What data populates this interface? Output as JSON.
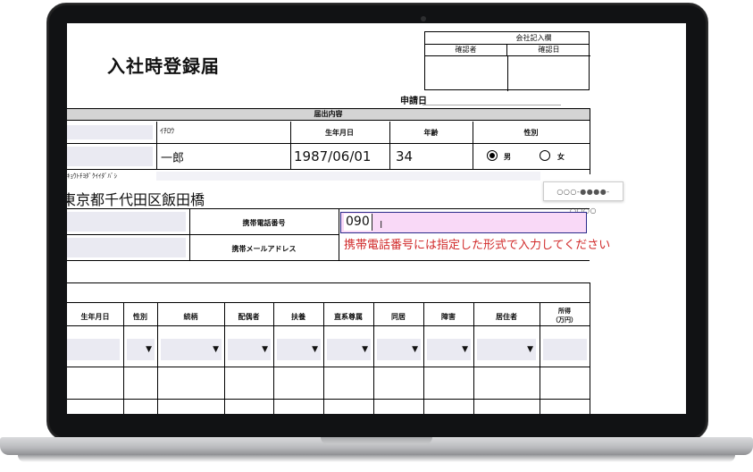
{
  "form": {
    "title": "入社時登録届",
    "stamp": {
      "header": "会社記入欄",
      "confirmer": "確認者",
      "confirm_date": "確認日"
    },
    "apply_date_label": "申請日",
    "section_label": "届出内容",
    "name_kana_value": "ｲﾁﾛｳ",
    "name_value": "一郎",
    "birth_label": "生年月日",
    "birth_value": "1987/06/01",
    "age_label": "年齢",
    "age_value": "34",
    "gender_label": "性別",
    "gender_male": "男",
    "gender_female": "女",
    "gender_selected": "男",
    "address_kana": "ｷｮｳﾄﾁﾖﾀﾞｸｲｲﾀﾞﾊﾞｼ",
    "address_value": "東京都千代田区飯田橋",
    "mobile_label": "携帯電話番号",
    "mobile_value": "090",
    "mobile_placeholder_hint": "○○○-●●●●-○○○○",
    "mobile_mail_label": "携帯メールアドレス",
    "error_message": "携帯電話番号には指定した形式で入力してください"
  },
  "family_table": {
    "headers": [
      "生年月日",
      "性別",
      "続柄",
      "配偶者",
      "扶養",
      "直系尊属",
      "同居",
      "障害",
      "居住者"
    ],
    "income_header_line1": "所得",
    "income_header_line2": "（万円）",
    "dropdown_arrow": "▼"
  }
}
